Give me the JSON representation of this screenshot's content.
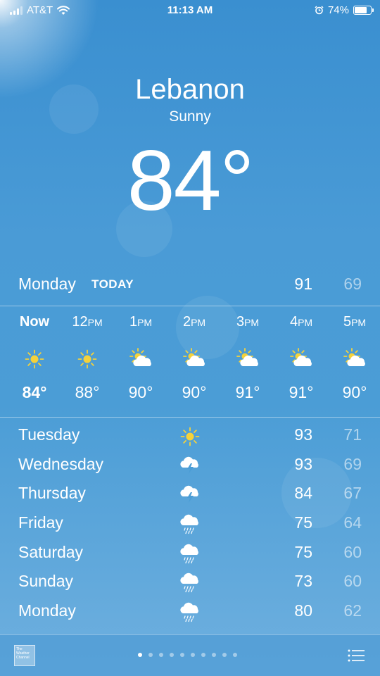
{
  "status_bar": {
    "carrier": "AT&T",
    "time": "11:13 AM",
    "battery": "74%",
    "battery_level": 0.74
  },
  "location": {
    "city": "Lebanon",
    "condition": "Sunny",
    "temperature": "84°"
  },
  "today": {
    "day": "Monday",
    "label": "TODAY",
    "high": "91",
    "low": "69"
  },
  "hourly": [
    {
      "time": "Now",
      "suffix": "",
      "icon": "sun-icon",
      "temp": "84°"
    },
    {
      "time": "12",
      "suffix": "PM",
      "icon": "sun-icon",
      "temp": "88°"
    },
    {
      "time": "1",
      "suffix": "PM",
      "icon": "partly-cloudy-icon",
      "temp": "90°"
    },
    {
      "time": "2",
      "suffix": "PM",
      "icon": "partly-cloudy-icon",
      "temp": "90°"
    },
    {
      "time": "3",
      "suffix": "PM",
      "icon": "partly-cloudy-icon",
      "temp": "91°"
    },
    {
      "time": "4",
      "suffix": "PM",
      "icon": "partly-cloudy-icon",
      "temp": "91°"
    },
    {
      "time": "5",
      "suffix": "PM",
      "icon": "partly-cloudy-icon",
      "temp": "90°"
    }
  ],
  "daily": [
    {
      "day": "Tuesday",
      "icon": "sun-icon",
      "high": "93",
      "low": "71"
    },
    {
      "day": "Wednesday",
      "icon": "thunderstorm-icon",
      "high": "93",
      "low": "69"
    },
    {
      "day": "Thursday",
      "icon": "thunderstorm-icon",
      "high": "84",
      "low": "67"
    },
    {
      "day": "Friday",
      "icon": "rain-icon",
      "high": "75",
      "low": "64"
    },
    {
      "day": "Saturday",
      "icon": "rain-icon",
      "high": "75",
      "low": "60"
    },
    {
      "day": "Sunday",
      "icon": "rain-icon",
      "high": "73",
      "low": "60"
    },
    {
      "day": "Monday",
      "icon": "rain-icon",
      "high": "80",
      "low": "62"
    }
  ],
  "toolbar": {
    "logo_text": "The Weather Channel",
    "page_count": 10,
    "active_page": 0
  },
  "colors": {
    "sky": "#4b9dd6",
    "sun": "#f5d23a",
    "low_temp": "#a9d0ee"
  }
}
